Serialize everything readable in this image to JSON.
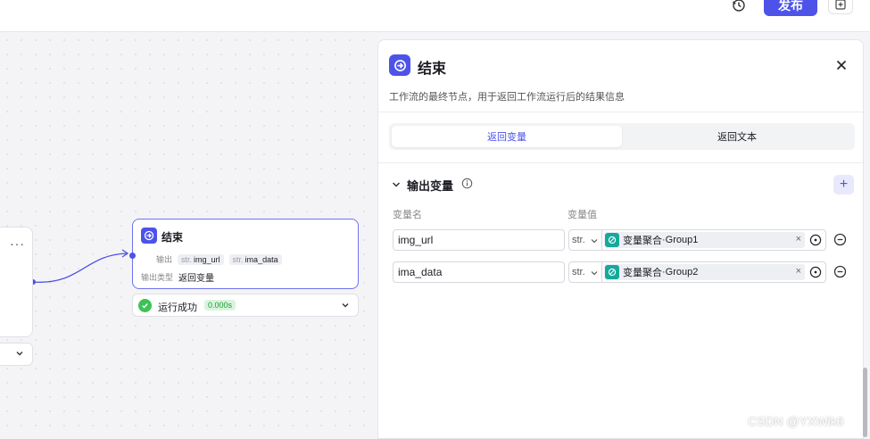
{
  "toolbar": {
    "history_icon": "history-icon",
    "publish_label": "发布",
    "add_page_icon": "add-page-icon",
    "brand_color": "#4d53e8"
  },
  "canvas": {
    "prev_node": {
      "more_label": "···"
    },
    "end_node": {
      "title": "结束",
      "output_label": "输出",
      "outputs": [
        {
          "type": "str.",
          "name": "img_url"
        },
        {
          "type": "str.",
          "name": "ima_data"
        }
      ],
      "output_type_label": "输出类型",
      "output_type_value": "返回变量"
    },
    "run_status": {
      "text": "运行成功",
      "time": "0.000s",
      "status_color": "#3ec254"
    }
  },
  "panel": {
    "title": "结束",
    "description": "工作流的最终节点，用于返回工作流运行后的结果信息",
    "tabs": [
      {
        "label": "返回变量",
        "active": true
      },
      {
        "label": "返回文本",
        "active": false
      }
    ],
    "section_title": "输出变量",
    "col_name_label": "变量名",
    "col_value_label": "变量值",
    "rows": [
      {
        "name": "img_url",
        "type": "str.",
        "value_source": "变量聚合",
        "value_sep": " · ",
        "value_var": "Group1",
        "clear": "×"
      },
      {
        "name": "ima_data",
        "type": "str.",
        "value_source": "变量聚合",
        "value_sep": " · ",
        "value_var": "Group2",
        "clear": "×"
      }
    ],
    "add_label": "+"
  },
  "watermark": "CSDN @YXWik6"
}
